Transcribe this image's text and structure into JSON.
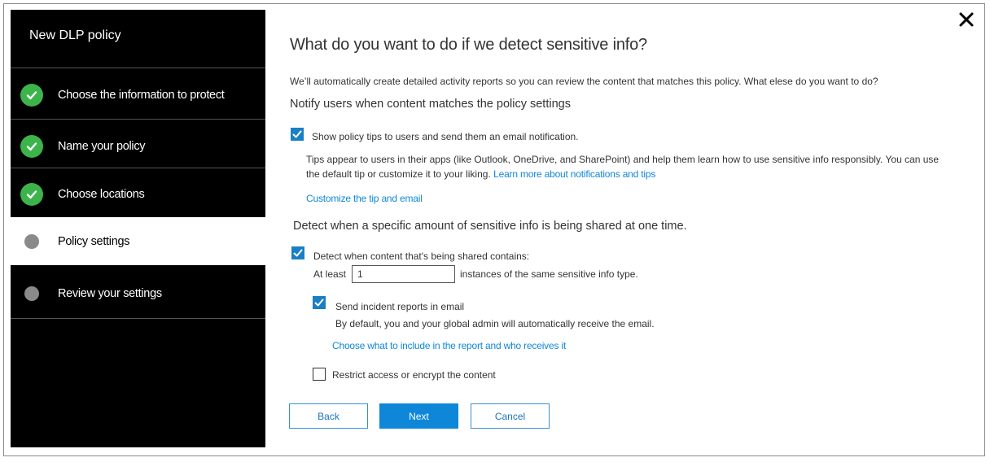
{
  "sidebar": {
    "title": "New DLP policy",
    "steps": [
      {
        "label": "Choose the information to protect",
        "state": "done"
      },
      {
        "label": "Name your policy",
        "state": "done"
      },
      {
        "label": "Choose locations",
        "state": "done"
      },
      {
        "label": "Policy settings",
        "state": "active"
      },
      {
        "label": "Review your settings",
        "state": "pending"
      }
    ]
  },
  "main": {
    "title": "What do you want to do if we detect sensitive info?",
    "intro": "We’ll automatically create detailed activity reports so you can review the content that matches this policy. What elese do you want to do?",
    "notify_heading": "Notify users when content matches the policy settings",
    "policy_tips": {
      "label": "Show policy tips to users and send them an email notification.",
      "checked": true,
      "desc_line1": "Tips appear to users in their apps (like Outlook, OneDrive, and SharePoint) and help them learn how to use sensitive info responsibly. You can use",
      "desc_line2": "the default tip or customize it to your liking.",
      "learn_more": "Learn more about notifications and tips",
      "customize_link": "Customize the tip and email"
    },
    "detect_heading": "Detect when a specific amount of sensitive info is being shared at one time.",
    "detect": {
      "label": "Detect when content that's being shared contains:",
      "checked": true,
      "at_least": "At least",
      "count_value": "1",
      "instances_text": "instances of the same sensitive info type."
    },
    "incident": {
      "label": "Send incident reports in email",
      "checked": true,
      "desc": "By default, you and your global admin will automatically receive the email.",
      "link": "Choose what to include in the report and who receives it"
    },
    "restrict": {
      "label": "Restrict access or encrypt the content",
      "checked": false
    }
  },
  "buttons": {
    "back": "Back",
    "next": "Next",
    "cancel": "Cancel"
  },
  "colors": {
    "accent": "#0f87d8",
    "check_green": "#3cb44b",
    "sidebar_bg": "#000000"
  }
}
